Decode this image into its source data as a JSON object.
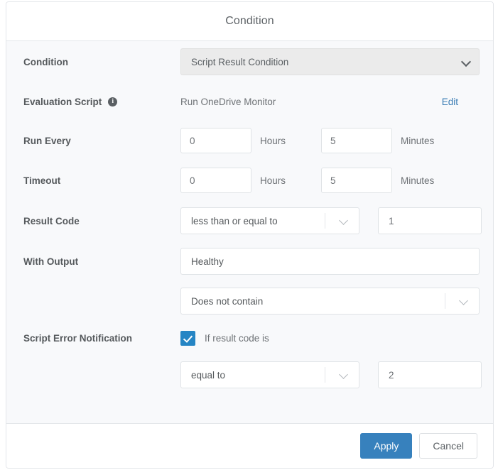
{
  "dialog": {
    "title": "Condition"
  },
  "rows": {
    "condition": {
      "label": "Condition",
      "value": "Script Result Condition"
    },
    "evaluation_script": {
      "label": "Evaluation Script",
      "info_icon": "info-icon",
      "value": "Run OneDrive Monitor",
      "edit_link": "Edit"
    },
    "run_every": {
      "label": "Run Every",
      "hours_value": "0",
      "hours_unit": "Hours",
      "minutes_value": "5",
      "minutes_unit": "Minutes"
    },
    "timeout": {
      "label": "Timeout",
      "hours_value": "0",
      "hours_unit": "Hours",
      "minutes_value": "5",
      "minutes_unit": "Minutes"
    },
    "result_code": {
      "label": "Result Code",
      "operator": "less than or equal to",
      "value": "1"
    },
    "with_output": {
      "label": "With Output",
      "text_value": "Healthy",
      "match_mode": "Does not contain"
    },
    "script_error_notification": {
      "label": "Script Error Notification",
      "checkbox_label": "If result code is",
      "checkbox_checked": true,
      "operator": "equal to",
      "value": "2"
    }
  },
  "footer": {
    "apply_label": "Apply",
    "cancel_label": "Cancel"
  },
  "colors": {
    "accent_blue": "#3781bd",
    "checkbox_blue": "#2585c4",
    "link_blue": "#3d7eb5",
    "body_bg": "#f8f9fb",
    "label_text": "#55595c"
  }
}
